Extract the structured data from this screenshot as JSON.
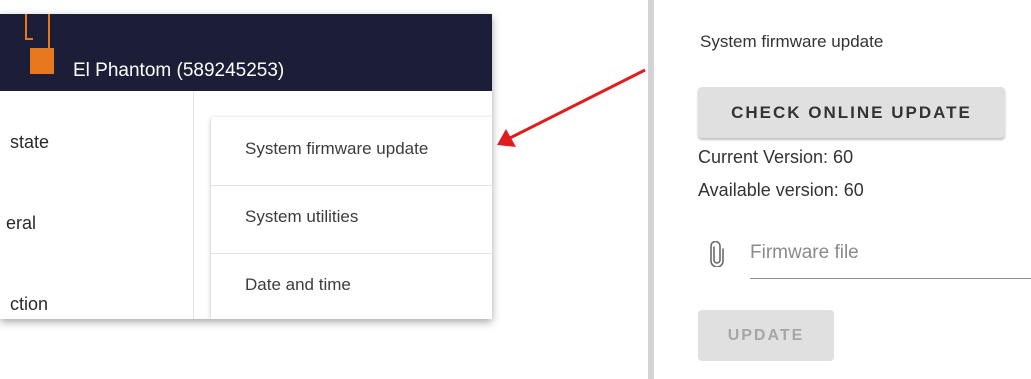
{
  "header": {
    "device_title": "El Phantom (589245253)",
    "logo_icon": "antenna-device-icon",
    "background_color": "#1c1d37",
    "logo_color": "#e8781d"
  },
  "sidebar": {
    "items": [
      {
        "label": "state"
      },
      {
        "label": "eral"
      },
      {
        "label": "ction"
      }
    ]
  },
  "system_menu": {
    "items": [
      {
        "label": "System firmware update"
      },
      {
        "label": "System utilities"
      },
      {
        "label": "Date and time"
      }
    ]
  },
  "annotation": {
    "arrow_color": "#e01d1d"
  },
  "firmware": {
    "title": "System firmware update",
    "check_button_label": "CHECK ONLINE UPDATE",
    "current_version": "Current Version: 60",
    "available_version": "Available version: 60",
    "file_field_placeholder": "Firmware file",
    "file_icon": "paperclip-icon",
    "update_button_label": "UPDATE"
  }
}
